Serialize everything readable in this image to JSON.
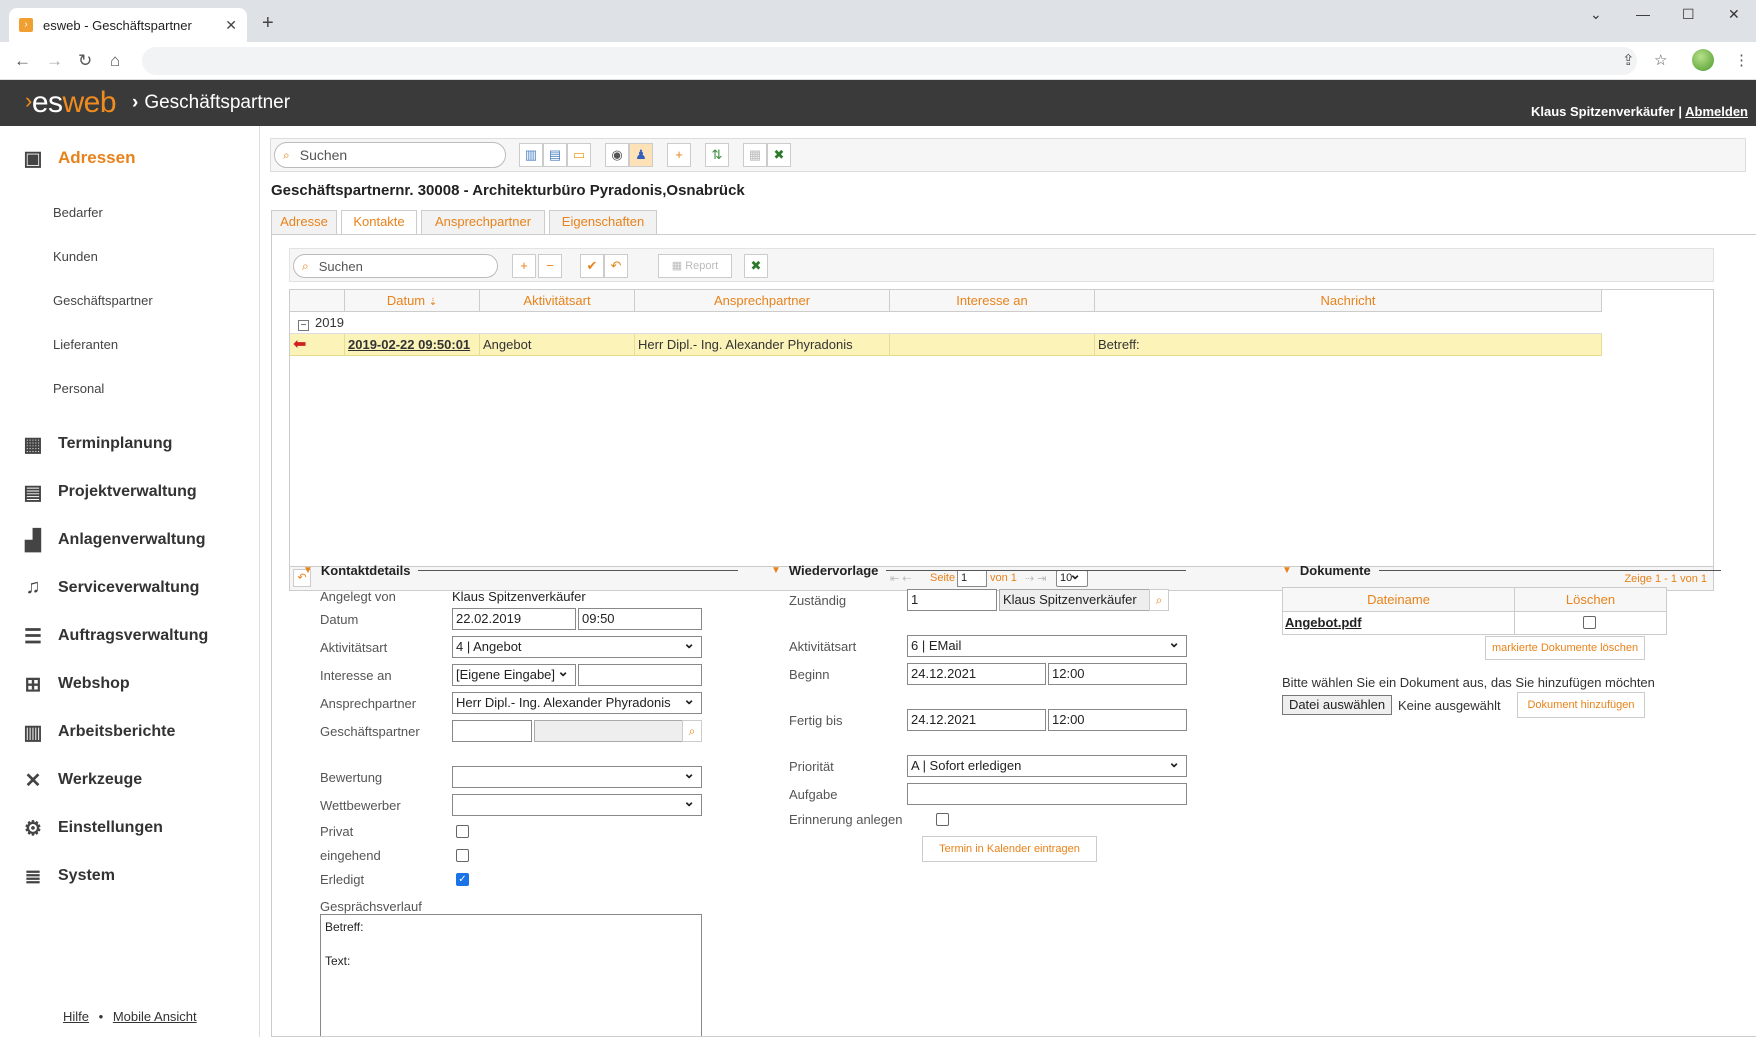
{
  "browser": {
    "tab_title": "esweb - Geschäftspartner"
  },
  "app": {
    "logo_a": "es",
    "logo_b": "web",
    "section": "Geschäftspartner",
    "user": "Klaus Spitzenverkäufer",
    "separator": "|",
    "logout": "Abmelden"
  },
  "sidebar": {
    "active": "Adressen",
    "sub": [
      "Bedarfer",
      "Kunden",
      "Geschäftspartner",
      "Lieferanten",
      "Personal"
    ],
    "items": [
      "Terminplanung",
      "Projektverwaltung",
      "Anlagenverwaltung",
      "Serviceverwaltung",
      "Auftragsverwaltung",
      "Webshop",
      "Arbeitsberichte",
      "Werkzeuge",
      "Einstellungen",
      "System"
    ],
    "footer": {
      "help": "Hilfe",
      "dot": "•",
      "mobile": "Mobile Ansicht"
    }
  },
  "toolbar": {
    "search_placeholder": "Suchen"
  },
  "page": {
    "title": "Geschäftspartnernr. 30008 - Architekturbüro Pyradonis,Osnabrück"
  },
  "tabs": [
    "Adresse",
    "Kontakte",
    "Ansprechpartner",
    "Eigenschaften"
  ],
  "grid": {
    "search_placeholder": "Suchen",
    "report": "Report",
    "columns": [
      "Datum",
      "Aktivitätsart",
      "Ansprechpartner",
      "Interesse an",
      "Nachricht"
    ],
    "group": "2019",
    "rows": [
      {
        "datum": "2019-02-22 09:50:01",
        "aktivitaet": "Angebot",
        "ansprechpartner": "Herr Dipl.- Ing. Alexander Phyradonis",
        "interesse": "",
        "nachricht": "Betreff:"
      }
    ],
    "pager": {
      "page_label": "Seite",
      "page": "1",
      "of": "von 1",
      "size": "10",
      "summary": "Zeige 1 - 1 von 1"
    }
  },
  "kontakt": {
    "title": "Kontaktdetails",
    "labels": {
      "angelegt": "Angelegt von",
      "datum": "Datum",
      "aktivitaet": "Aktivitätsart",
      "interesse": "Interesse an",
      "ansprechpartner": "Ansprechpartner",
      "gp": "Geschäftspartner",
      "bewertung": "Bewertung",
      "wettbewerber": "Wettbewerber",
      "privat": "Privat",
      "eingehend": "eingehend",
      "erledigt": "Erledigt",
      "verlauf": "Gesprächsverlauf"
    },
    "values": {
      "angelegt": "Klaus Spitzenverkäufer",
      "datum": "22.02.2019",
      "zeit": "09:50",
      "aktivitaet": "4 | Angebot",
      "interesse": "[Eigene Eingabe]",
      "ansprechpartner": "Herr Dipl.- Ing. Alexander Phyradonis",
      "verlauf_1": "Betreff:",
      "verlauf_2": "Text:"
    },
    "privat": false,
    "eingehend": false,
    "erledigt": true
  },
  "wiedervorlage": {
    "title": "Wiedervorlage",
    "labels": {
      "zustaendig": "Zuständig",
      "aktivitaet": "Aktivitätsart",
      "beginn": "Beginn",
      "fertig": "Fertig bis",
      "prioritaet": "Priorität",
      "aufgabe": "Aufgabe",
      "erinnerung": "Erinnerung anlegen"
    },
    "values": {
      "zust_id": "1",
      "zust_name": "Klaus Spitzenverkäufer",
      "aktivitaet": "6 | EMail",
      "beginn_d": "24.12.2021",
      "beginn_t": "12:00",
      "fertig_d": "24.12.2021",
      "fertig_t": "12:00",
      "prioritaet": "A | Sofort erledigen"
    },
    "button": "Termin in Kalender eintragen"
  },
  "dokumente": {
    "title": "Dokumente",
    "columns": [
      "Dateiname",
      "Löschen"
    ],
    "file": "Angebot.pdf",
    "delete_btn": "markierte Dokumente löschen",
    "hint": "Bitte wählen Sie ein Dokument aus, das Sie hinzufügen möchten",
    "choose": "Datei auswählen",
    "none": "Keine ausgewählt",
    "add_btn": "Dokument hinzufügen"
  },
  "colors": {
    "accent": "#e8821a",
    "appbar": "#3a3a3a",
    "row_highlight": "#fbf3b8"
  }
}
